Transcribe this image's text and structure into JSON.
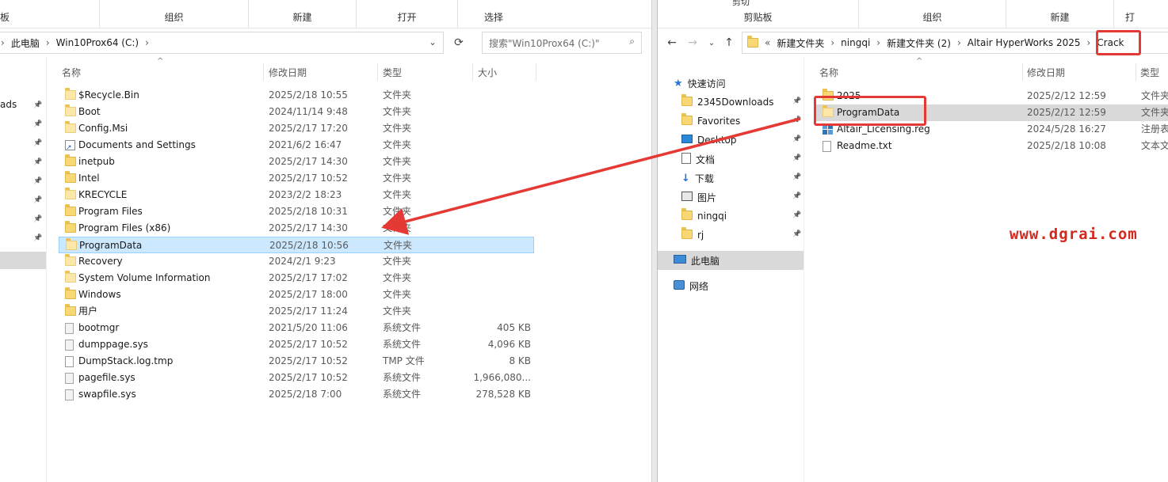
{
  "left": {
    "ribbon": {
      "groups": [
        "组织",
        "新建",
        "打开",
        "选择"
      ],
      "partial_label": "板"
    },
    "address": {
      "crumbs": [
        "此电脑",
        "Win10Prox64 (C:)"
      ]
    },
    "search_placeholder": "搜索\"Win10Prox64 (C:)\"",
    "nav_partial": "ads",
    "columns": {
      "name": "名称",
      "date": "修改日期",
      "type": "类型",
      "size": "大小"
    },
    "files": [
      {
        "name": "$Recycle.Bin",
        "date": "2025/2/18 10:55",
        "type": "文件夹",
        "size": "",
        "icon": "folder-light"
      },
      {
        "name": "Boot",
        "date": "2024/11/14 9:48",
        "type": "文件夹",
        "size": "",
        "icon": "folder-light"
      },
      {
        "name": "Config.Msi",
        "date": "2025/2/17 17:20",
        "type": "文件夹",
        "size": "",
        "icon": "folder-light"
      },
      {
        "name": "Documents and Settings",
        "date": "2021/6/2 16:47",
        "type": "文件夹",
        "size": "",
        "icon": "shortcut"
      },
      {
        "name": "inetpub",
        "date": "2025/2/17 14:30",
        "type": "文件夹",
        "size": "",
        "icon": "folder"
      },
      {
        "name": "Intel",
        "date": "2025/2/17 10:52",
        "type": "文件夹",
        "size": "",
        "icon": "folder"
      },
      {
        "name": "KRECYCLE",
        "date": "2023/2/2 18:23",
        "type": "文件夹",
        "size": "",
        "icon": "folder-light"
      },
      {
        "name": "Program Files",
        "date": "2025/2/18 10:31",
        "type": "文件夹",
        "size": "",
        "icon": "folder"
      },
      {
        "name": "Program Files (x86)",
        "date": "2025/2/17 14:30",
        "type": "文件夹",
        "size": "",
        "icon": "folder"
      },
      {
        "name": "ProgramData",
        "date": "2025/2/18 10:56",
        "type": "文件夹",
        "size": "",
        "icon": "folder-light",
        "selected": true
      },
      {
        "name": "Recovery",
        "date": "2024/2/1 9:23",
        "type": "文件夹",
        "size": "",
        "icon": "folder-light"
      },
      {
        "name": "System Volume Information",
        "date": "2025/2/17 17:02",
        "type": "文件夹",
        "size": "",
        "icon": "folder-light"
      },
      {
        "name": "Windows",
        "date": "2025/2/17 18:00",
        "type": "文件夹",
        "size": "",
        "icon": "folder"
      },
      {
        "name": "用户",
        "date": "2025/2/17 11:24",
        "type": "文件夹",
        "size": "",
        "icon": "folder"
      },
      {
        "name": "bootmgr",
        "date": "2021/5/20 11:06",
        "type": "系统文件",
        "size": "405 KB",
        "icon": "sysfile"
      },
      {
        "name": "dumppage.sys",
        "date": "2025/2/17 10:52",
        "type": "系统文件",
        "size": "4,096 KB",
        "icon": "sysfile"
      },
      {
        "name": "DumpStack.log.tmp",
        "date": "2025/2/17 10:52",
        "type": "TMP 文件",
        "size": "8 KB",
        "icon": "file"
      },
      {
        "name": "pagefile.sys",
        "date": "2025/2/17 10:52",
        "type": "系统文件",
        "size": "1,966,080...",
        "icon": "sysfile"
      },
      {
        "name": "swapfile.sys",
        "date": "2025/2/18 7:00",
        "type": "系统文件",
        "size": "278,528 KB",
        "icon": "sysfile"
      }
    ]
  },
  "right": {
    "ribbon": {
      "groups": [
        "剪贴板",
        "组织",
        "新建",
        "打"
      ],
      "partial_top": "剪切"
    },
    "address": {
      "prefix": "«",
      "crumbs": [
        "新建文件夹",
        "ningqi",
        "新建文件夹 (2)",
        "Altair HyperWorks 2025",
        "Crack"
      ]
    },
    "columns": {
      "name": "名称",
      "date": "修改日期",
      "type": "类型"
    },
    "nav": [
      {
        "label": "快速访问",
        "icon": "star",
        "pinned": false,
        "indent": 0
      },
      {
        "label": "2345Downloads",
        "icon": "folder",
        "pinned": true,
        "indent": 1
      },
      {
        "label": "Favorites",
        "icon": "folder",
        "pinned": true,
        "indent": 1
      },
      {
        "label": "Desktop",
        "icon": "desktop",
        "pinned": true,
        "indent": 1
      },
      {
        "label": "文档",
        "icon": "doc",
        "pinned": true,
        "indent": 1
      },
      {
        "label": "下载",
        "icon": "down",
        "pinned": true,
        "indent": 1
      },
      {
        "label": "图片",
        "icon": "pic",
        "pinned": true,
        "indent": 1
      },
      {
        "label": "ningqi",
        "icon": "folder",
        "pinned": true,
        "indent": 1
      },
      {
        "label": "rj",
        "icon": "folder",
        "pinned": true,
        "indent": 1
      },
      {
        "label": "此电脑",
        "icon": "pc",
        "pinned": false,
        "indent": 0,
        "selected": true
      },
      {
        "label": "网络",
        "icon": "net",
        "pinned": false,
        "indent": 0
      }
    ],
    "files": [
      {
        "name": "2025",
        "date": "2025/2/12 12:59",
        "type": "文件夹",
        "icon": "folder"
      },
      {
        "name": "ProgramData",
        "date": "2025/2/12 12:59",
        "type": "文件夹",
        "icon": "folder-light",
        "selected": true
      },
      {
        "name": "Altair_Licensing.reg",
        "date": "2024/5/28 16:27",
        "type": "注册表",
        "icon": "reg"
      },
      {
        "name": "Readme.txt",
        "date": "2025/2/18 10:08",
        "type": "文本文",
        "icon": "file"
      }
    ]
  },
  "watermark": "www.dgrai.com",
  "colors": {
    "annotation": "#e53935",
    "selection": "#cce8ff",
    "watermark": "#d22a1f"
  }
}
